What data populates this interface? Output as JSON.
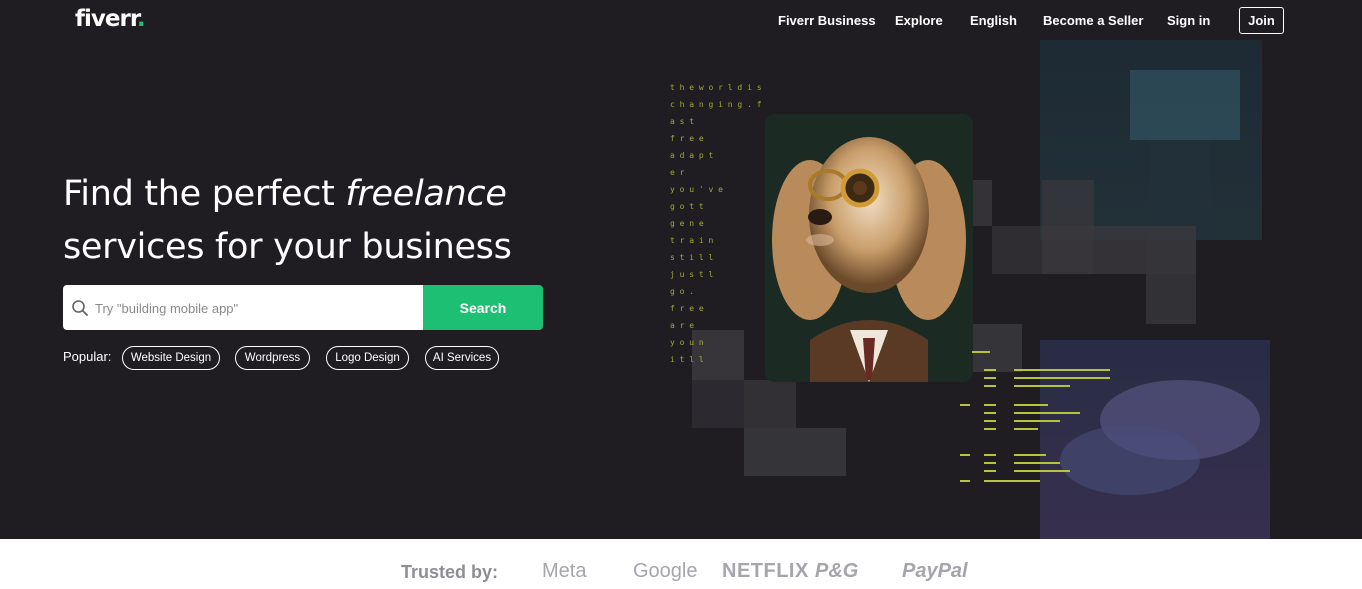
{
  "header": {
    "logo_text": "fiverr",
    "logo_dot": ".",
    "nav": [
      {
        "label": "Fiverr Business"
      },
      {
        "label": "Explore"
      },
      {
        "label": "English"
      },
      {
        "label": "Become a Seller"
      },
      {
        "label": "Sign in"
      }
    ],
    "join_label": "Join"
  },
  "hero": {
    "headline_part1": "Find the perfect ",
    "headline_emphasis": "freelance",
    "headline_part2": "services for your business",
    "search": {
      "placeholder": "Try \"building mobile app\"",
      "value": "",
      "button_label": "Search"
    },
    "popular": {
      "label": "Popular:",
      "items": [
        {
          "label": "Website Design"
        },
        {
          "label": "Wordpress"
        },
        {
          "label": "Logo Design"
        },
        {
          "label": "AI Services"
        }
      ]
    },
    "matrix_text": [
      "t  h e  w o  r l d  i s",
      "c h  a n g  i n g .  f",
      "a s t",
      "f r  e e",
      "a d a p t",
      "e r",
      "y o u ' v e",
      "g o  t t",
      "g e  n e",
      "t r a i n",
      "s t i l l",
      "j u s t  l",
      "g o .",
      "f r e e",
      "a r e",
      "y o u  n",
      "i t  l l"
    ]
  },
  "trusted": {
    "label": "Trusted by:",
    "brands": [
      "Meta",
      "Google",
      "NETFLIX",
      "P&G",
      "PayPal"
    ]
  },
  "colors": {
    "hero_bg": "#1f1c22",
    "accent_green": "#1dbf73",
    "code_green": "#b5c43a"
  }
}
